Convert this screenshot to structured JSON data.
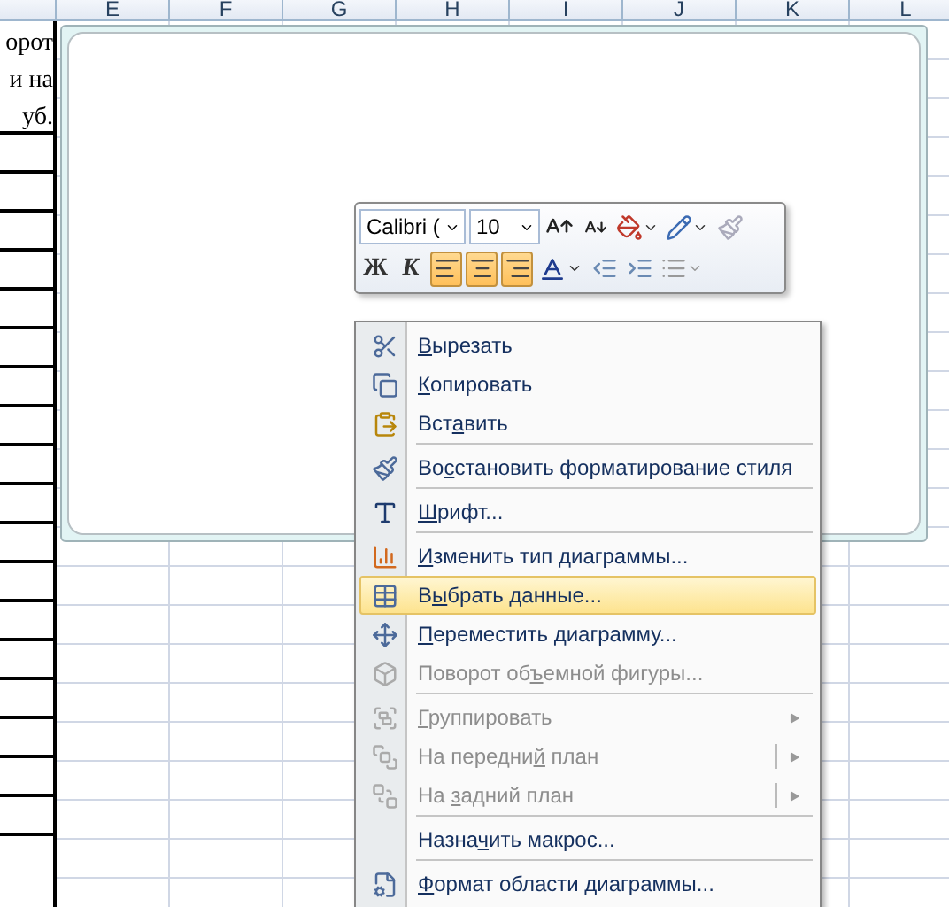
{
  "columns": [
    "E",
    "F",
    "G",
    "H",
    "I",
    "J",
    "K",
    "L"
  ],
  "column_d": {
    "text_lines": [
      "орот",
      "и на",
      "уб."
    ]
  },
  "mini_toolbar": {
    "font": "Calibri (",
    "size": "10",
    "bold": "Ж",
    "italic": "К",
    "alignment": [
      {
        "selected": true
      },
      {
        "selected": true
      },
      {
        "selected": true
      }
    ]
  },
  "context_menu": {
    "items": [
      {
        "kind": "item",
        "key": "В",
        "post": "ырезать",
        "disabled": false,
        "selected": false
      },
      {
        "kind": "item",
        "key": "К",
        "post": "опировать",
        "disabled": false,
        "selected": false
      },
      {
        "kind": "item",
        "pre": "Вст",
        "key": "а",
        "post": "вить",
        "disabled": false,
        "selected": false
      },
      {
        "kind": "separator"
      },
      {
        "kind": "item",
        "pre": "Во",
        "key": "с",
        "post": "становить форматирование стиля",
        "disabled": false,
        "selected": false
      },
      {
        "kind": "separator"
      },
      {
        "kind": "item",
        "key": "Ш",
        "post": "рифт...",
        "disabled": false,
        "selected": false
      },
      {
        "kind": "separator"
      },
      {
        "kind": "item",
        "key": "И",
        "post": "зменить тип диаграммы...",
        "disabled": false,
        "selected": false
      },
      {
        "kind": "item",
        "pre": "В",
        "key": "ы",
        "post": "брать данные...",
        "disabled": false,
        "selected": true
      },
      {
        "kind": "item",
        "key": "П",
        "post": "ереместить диаграмму...",
        "disabled": false,
        "selected": false
      },
      {
        "kind": "item",
        "pre": "Поворот об",
        "key": "ъ",
        "post": "емной фигуры...",
        "disabled": true,
        "selected": false
      },
      {
        "kind": "separator"
      },
      {
        "kind": "item",
        "key": "Г",
        "post": "руппировать",
        "disabled": true,
        "selected": false,
        "submenu": true,
        "split": false
      },
      {
        "kind": "item",
        "pre": "На передни",
        "key": "й",
        "post": " план",
        "disabled": true,
        "selected": false,
        "submenu": true,
        "split": true
      },
      {
        "kind": "item",
        "pre": "На ",
        "key": "з",
        "post": "адний план",
        "disabled": true,
        "selected": false,
        "submenu": true,
        "split": true
      },
      {
        "kind": "separator"
      },
      {
        "kind": "item",
        "pre": "Назна",
        "key": "ч",
        "post": "ить макрос...",
        "disabled": false,
        "selected": false
      },
      {
        "kind": "separator"
      },
      {
        "kind": "item",
        "key": "Ф",
        "post": "ормат области диаграммы...",
        "disabled": false,
        "selected": false
      }
    ]
  }
}
